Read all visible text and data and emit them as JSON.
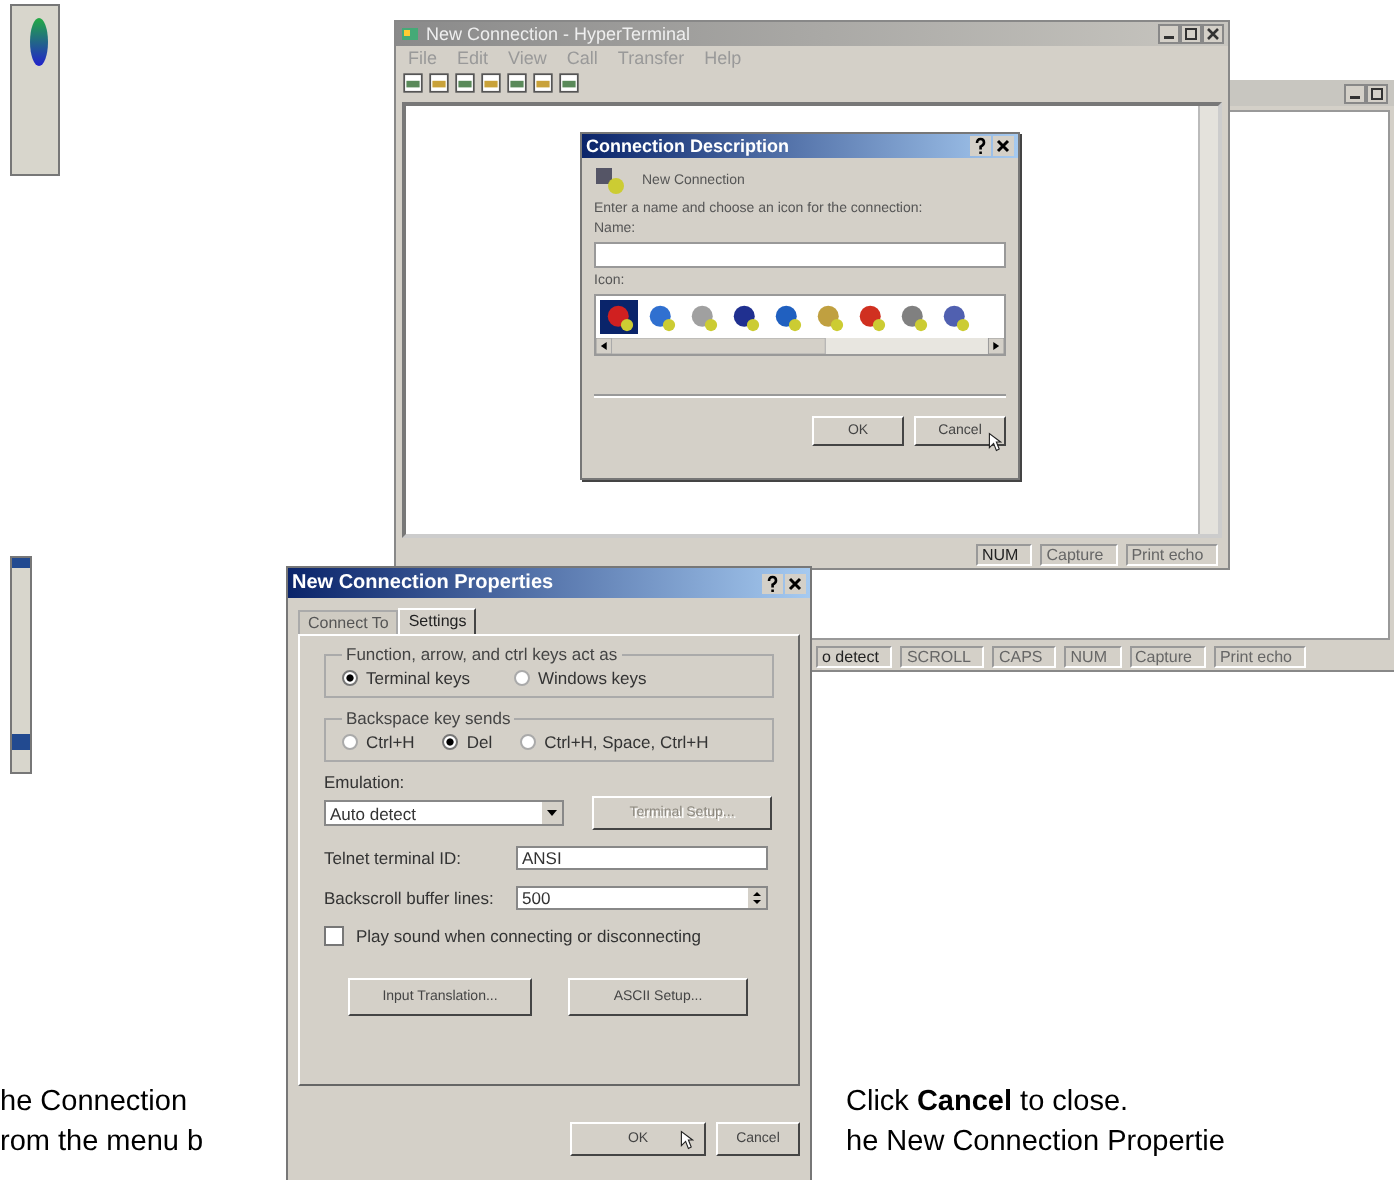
{
  "terminal_window": {
    "title": "New Connection - HyperTerminal",
    "menu": [
      "File",
      "Edit",
      "View",
      "Call",
      "Transfer",
      "Help"
    ],
    "status_bar": [
      "NUM",
      "Capture",
      "Print echo"
    ]
  },
  "second_window": {
    "status_bar": [
      "o detect",
      "SCROLL",
      "CAPS",
      "NUM",
      "Capture",
      "Print echo"
    ]
  },
  "connection_dialog": {
    "title": "Connection Description",
    "heading": "New Connection",
    "instruction": "Enter a name and choose an icon for the connection:",
    "name_label": "Name:",
    "icon_label": "Icon:",
    "icons": [
      {
        "selected": true,
        "color": "#d02020"
      },
      {
        "selected": false,
        "color": "#3070d0"
      },
      {
        "selected": false,
        "color": "#a0a0a0"
      },
      {
        "selected": false,
        "color": "#203090"
      },
      {
        "selected": false,
        "color": "#2060c0"
      },
      {
        "selected": false,
        "color": "#c0a040"
      },
      {
        "selected": false,
        "color": "#d03020"
      },
      {
        "selected": false,
        "color": "#808080"
      },
      {
        "selected": false,
        "color": "#5060b0"
      }
    ],
    "buttons": [
      "OK",
      "Cancel"
    ]
  },
  "properties_dialog": {
    "title": "New Connection Properties",
    "tabs": [
      {
        "label": "Connect To",
        "selected": false
      },
      {
        "label": "Settings",
        "selected": true
      }
    ],
    "groups": [
      {
        "legend": "Function, arrow, and ctrl keys act as",
        "options": [
          {
            "label": "Terminal keys",
            "selected": true
          },
          {
            "label": "Windows keys",
            "selected": false
          }
        ]
      },
      {
        "legend": "Backspace key sends",
        "options": [
          {
            "label": "Ctrl+H",
            "selected": false
          },
          {
            "label": "Del",
            "selected": true
          },
          {
            "label": "Ctrl+H, Space, Ctrl+H",
            "selected": false
          }
        ]
      }
    ],
    "emulation_label": "Emulation:",
    "emulation_value": "Auto detect",
    "terminal_setup": {
      "label": "Terminal Setup...",
      "disabled": true
    },
    "telnet_label": "Telnet terminal ID:",
    "telnet_value": "ANSI",
    "backscroll_label": "Backscroll buffer lines:",
    "backscroll_value": "500",
    "sound_option": {
      "label": "Play sound when connecting or disconnecting",
      "checked": false
    },
    "setup_buttons": [
      "Input Translation...",
      "ASCII Setup..."
    ],
    "buttons": [
      "OK",
      "Cancel"
    ]
  },
  "document_text": [
    {
      "left": "he Connection",
      "right": "Click **Cancel** to close."
    },
    {
      "left": "rom the menu b",
      "right": "he New Connection Propertie"
    }
  ]
}
